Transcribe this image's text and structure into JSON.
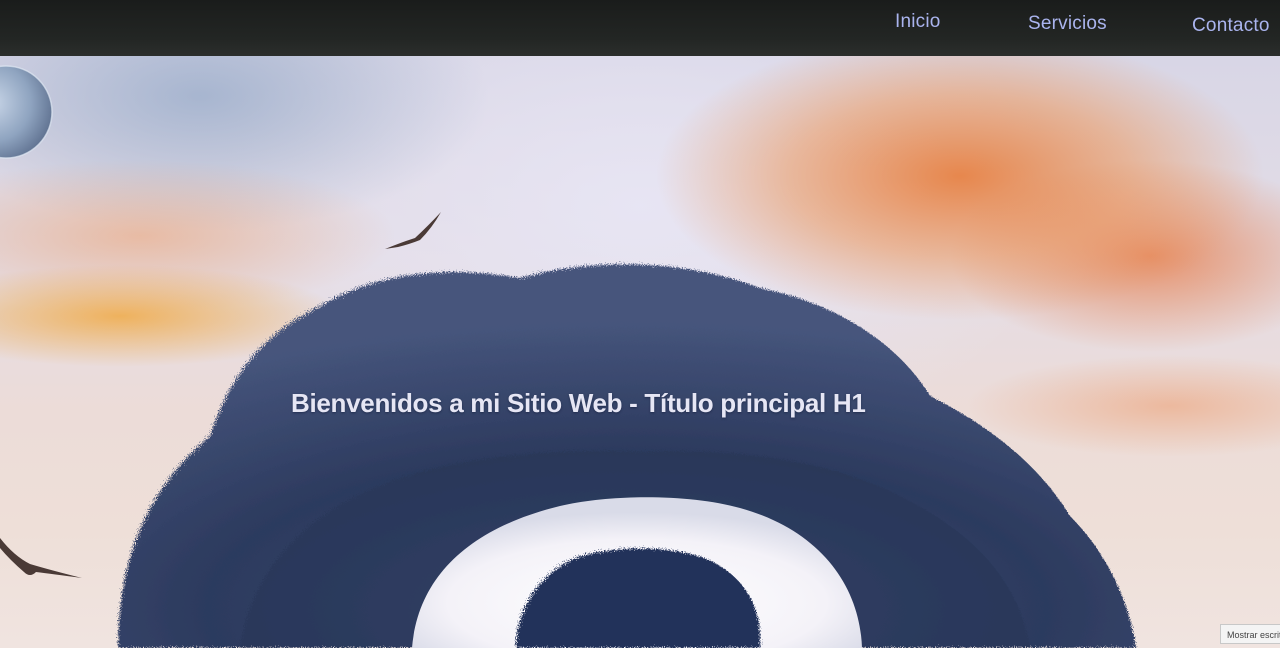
{
  "nav": {
    "items": [
      {
        "label": "Inicio"
      },
      {
        "label": "Servicios"
      },
      {
        "label": "Contacto"
      }
    ]
  },
  "hero": {
    "title": "Bienvenidos a mi Sitio Web - Título principal H1"
  },
  "taskbar": {
    "show_desktop_label": "Mostrar escritorio"
  },
  "colors": {
    "nav_background": "#222523",
    "nav_link": "#aab4ee",
    "hero_title": "#e6e6f4",
    "tree_foliage": "#2c3a5e",
    "sky_orange": "#e8783a"
  }
}
